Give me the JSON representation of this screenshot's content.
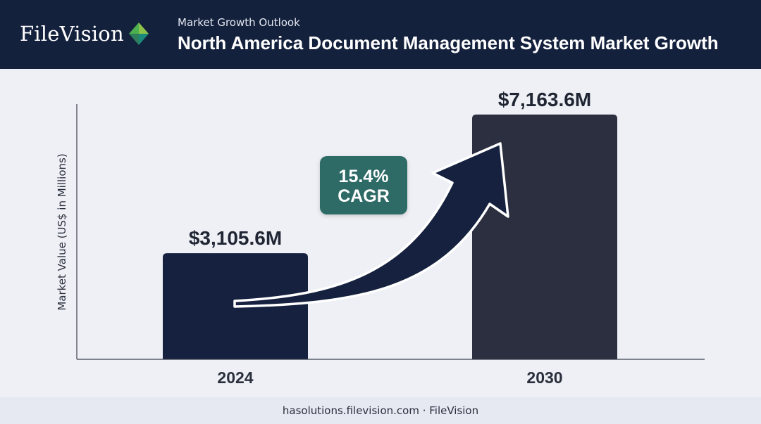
{
  "header": {
    "brand": "FileVision",
    "subtitle": "Market Growth Outlook",
    "title": "North America Document Management System Market Growth"
  },
  "chart_data": {
    "type": "bar",
    "categories": [
      "2024",
      "2030"
    ],
    "values": [
      3105.6,
      7163.6
    ],
    "value_labels": [
      "$3,105.6M",
      "$7,163.6M"
    ],
    "ylabel": "Market Value (US$ in Millions)",
    "xlabel": "",
    "ylim": [
      0,
      8500
    ],
    "grid": false,
    "bar_colors": [
      "#15213f",
      "#2c2f3f"
    ],
    "annotation": {
      "line1": "15.4%",
      "line2": "CAGR",
      "color": "#2f6b66"
    },
    "arrow": {
      "from": "2024",
      "to": "2030",
      "color": "#15213f"
    }
  },
  "footer": {
    "text": "hasolutions.filevision.com · FileVision"
  }
}
